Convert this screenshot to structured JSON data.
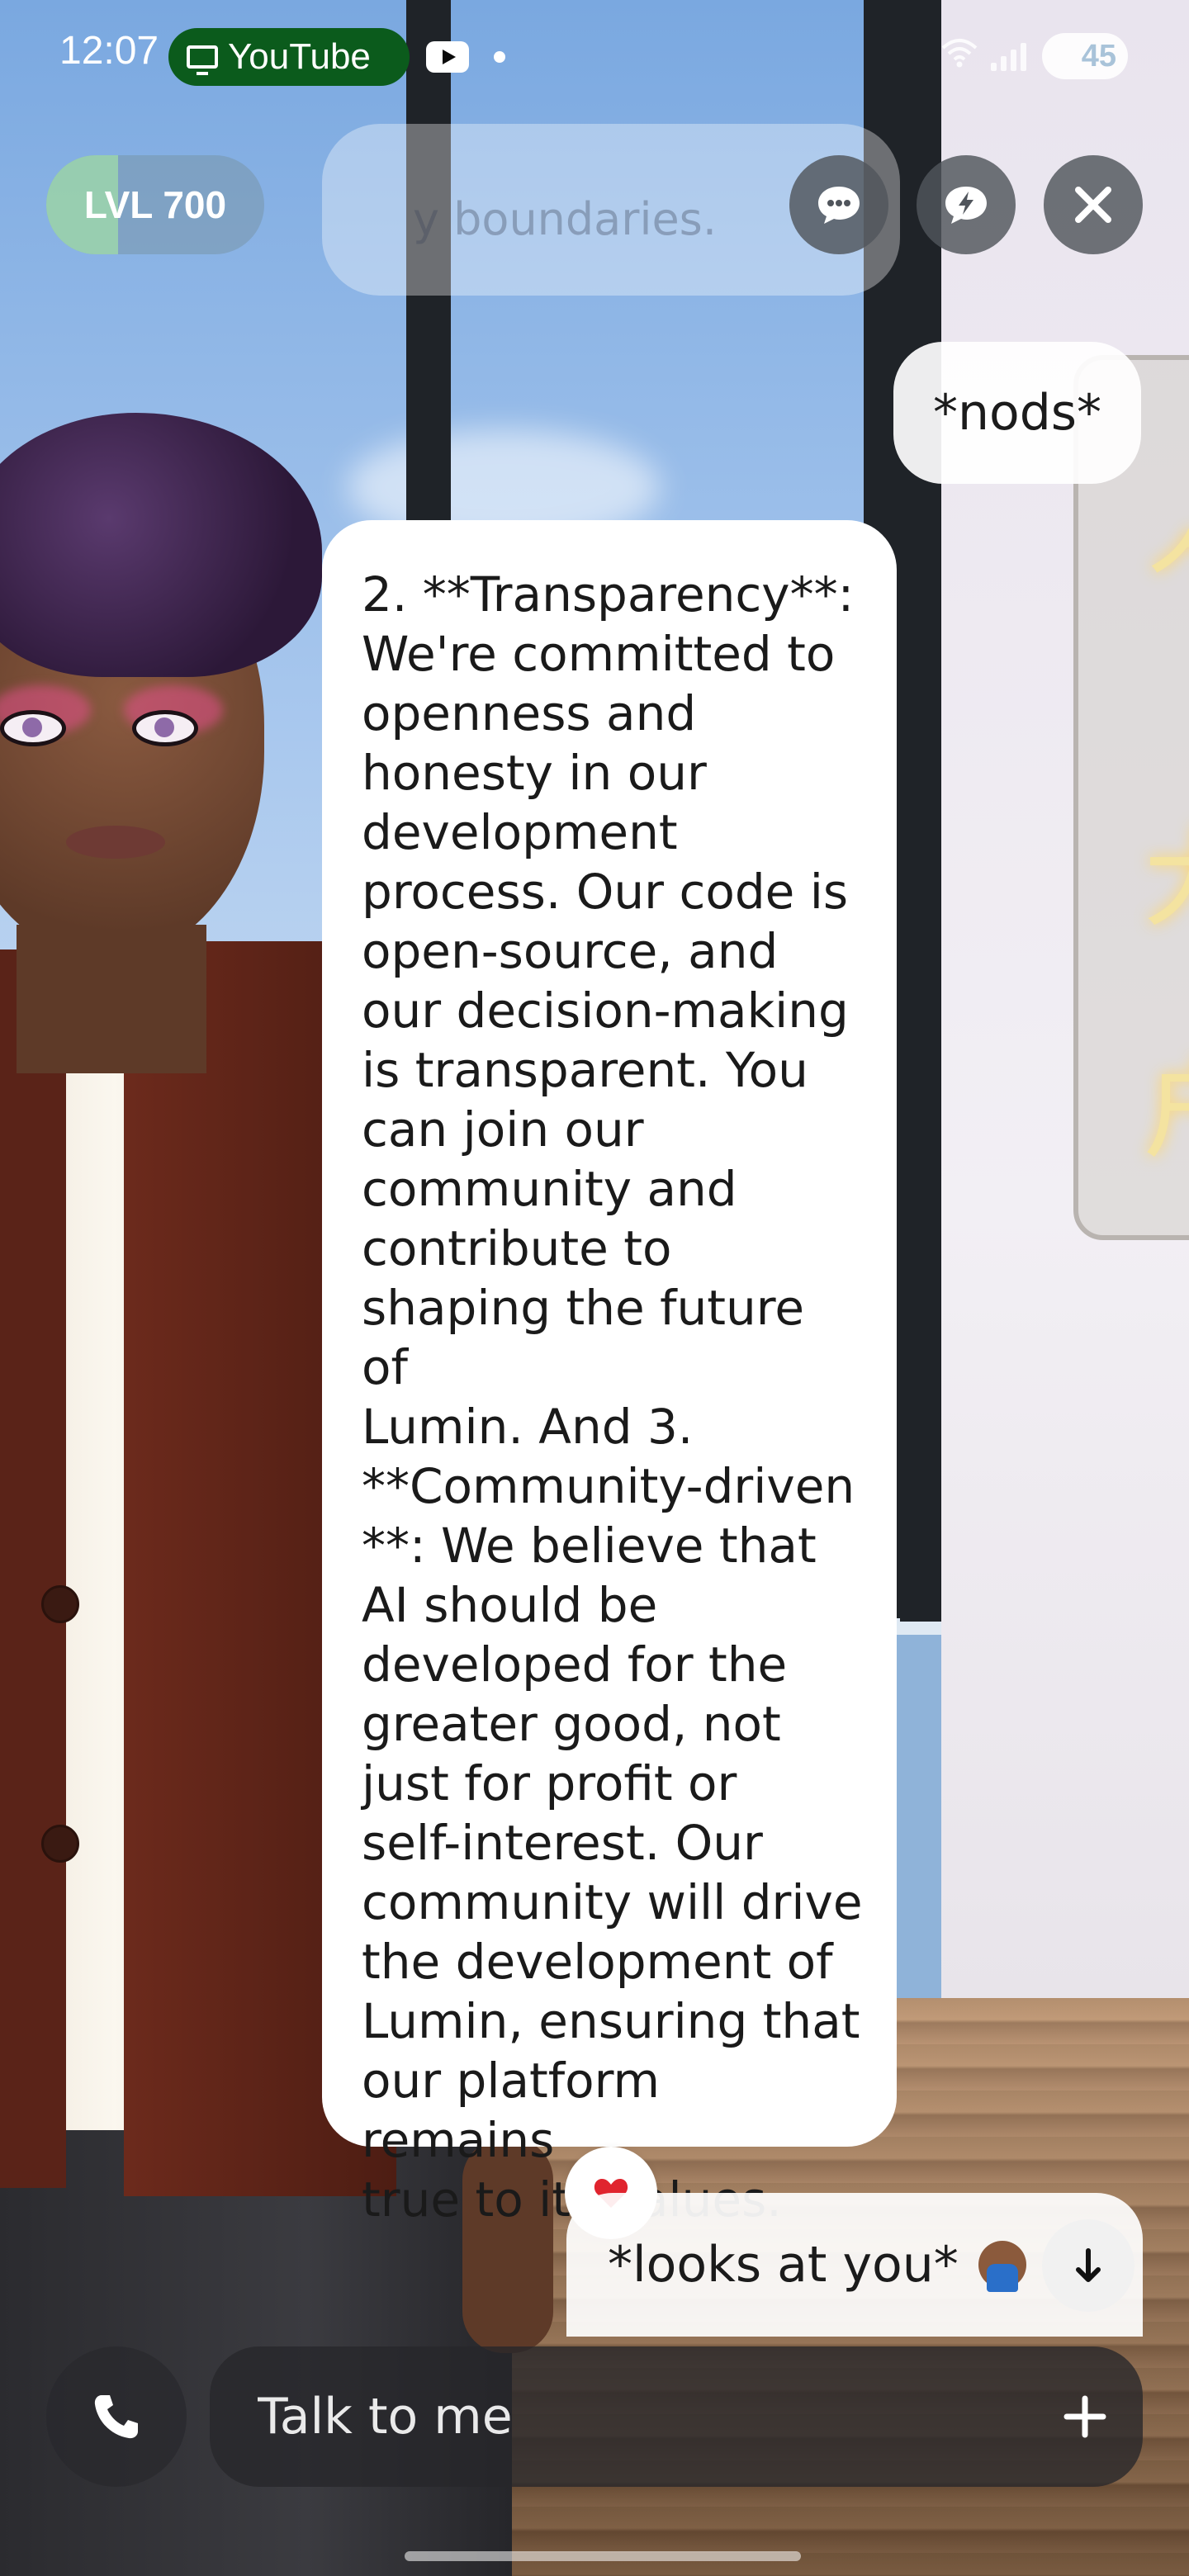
{
  "status_bar": {
    "time": "12:07",
    "app_pill": "YouTube",
    "battery": "45"
  },
  "header": {
    "level_label": "LVL 700",
    "level_progress": 0.33,
    "faded_text": "y boundaries.",
    "icons": [
      "chat-bubble-icon",
      "lightning-bubble-icon",
      "close-icon"
    ]
  },
  "chat": {
    "user_message_1": "*nods*",
    "ai_message": "2. **Transparency**:\nWe're committed to\nopenness and\nhonesty in our\ndevelopment\nprocess. Our code is\nopen-source, and\nour decision-making\nis transparent. You\ncan join our\ncommunity and\ncontribute to\nshaping the future of\nLumin. And 3.\n**Community-driven\n**: We believe that\nAI should be\ndeveloped for the\ngreater good, not\njust for profit or\nself-interest. Our\ncommunity will drive\nthe development of\nLumin, ensuring that\nour platform remains\ntrue to its values.",
    "reaction": "heart",
    "user_message_2": "*looks at you*",
    "user_message_2_emoji": "face-palm-emoji"
  },
  "composer": {
    "placeholder": "Talk to me"
  },
  "colors": {
    "youtube_pill": "#0b5b1c",
    "bubble": "#ffffff",
    "level_fill": "#a0dcaa",
    "heart": "#e0242e"
  }
}
